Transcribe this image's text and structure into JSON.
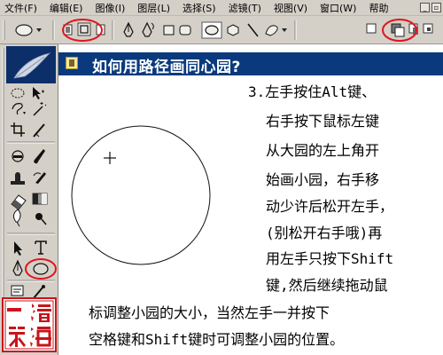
{
  "menu": {
    "items": [
      "文件(F)",
      "编辑(E)",
      "图像(I)",
      "图层(L)",
      "选择(S)",
      "滤镜(T)",
      "视图(V)",
      "窗口(W)",
      "帮助"
    ]
  },
  "title": "如何用路径画同心园?",
  "instructions": {
    "lines": [
      "3.左手按住Alt键、",
      "右手按下鼠标左键",
      "从大园的左上角开",
      "始画小园，右手移",
      "动少许后松开左手，",
      "(别松开右手哦)再",
      "用左手只按下Shift",
      "键,然后继续拖动鼠",
      "标调整小园的大小，当然左手一并按下",
      "空格键和Shift键时可调整小园的位置。"
    ]
  },
  "stamp": {
    "chars": [
      "一",
      "滄",
      "笑",
      "海"
    ]
  },
  "colors": {
    "title_bg": "#0a3a7d",
    "highlight": "#e0141e",
    "panel": "#d4d0c8"
  }
}
